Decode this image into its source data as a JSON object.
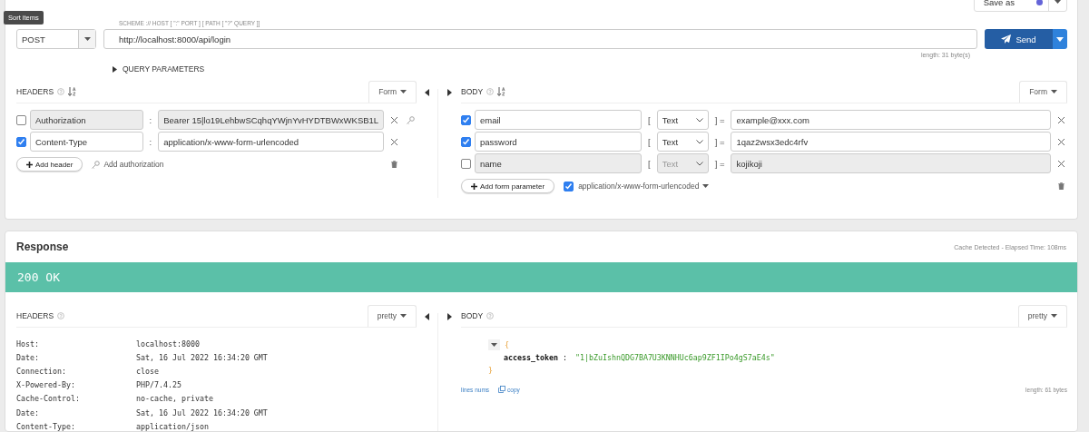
{
  "tooltip": {
    "text": "Sort items"
  },
  "request": {
    "save_button": "Save as",
    "method": "POST",
    "url_hint": "SCHEME :// HOST [ \":\" PORT ] [ PATH [ \"?\" QUERY ]]",
    "url": "http://localhost:8000/api/login",
    "url_length": "length: 31 byte(s)",
    "send_button": "Send",
    "query_parameters": {
      "label": "QUERY PARAMETERS",
      "expanded": false
    },
    "headers": {
      "title": "HEADERS",
      "mode": "Form",
      "add_button": "Add header",
      "add_auth": "Add authorization",
      "rows": [
        {
          "name": "Authorization",
          "separator": ":",
          "value": "Bearer 15|lo19LehbwSCqhqYWjnYvHYDTBWxWKSB1L",
          "checked": false
        },
        {
          "name": "Content-Type",
          "separator": ":",
          "value": "application/x-www-form-urlencoded",
          "checked": true
        }
      ]
    },
    "body": {
      "title": "BODY",
      "mode": "Form",
      "add_button": "Add form parameter",
      "content_type": {
        "label": "application/x-www-form-urlencoded",
        "checked": true
      },
      "rows": [
        {
          "name": "email",
          "open": "[",
          "type": "Text",
          "close": "] =",
          "value": "example@xxx.com",
          "checked": true
        },
        {
          "name": "password",
          "open": "[",
          "type": "Text",
          "close": "] =",
          "value": "1qaz2wsx3edc4rfv",
          "checked": true
        },
        {
          "name": "name",
          "open": "[",
          "type": "Text",
          "close": "] =",
          "value": "kojikoji",
          "checked": false
        }
      ]
    }
  },
  "response": {
    "title": "Response",
    "cache_info": "Cache Detected - Elapsed Time: 108ms",
    "status": "200 OK",
    "headers": {
      "title": "HEADERS",
      "mode": "pretty",
      "rows": [
        {
          "name": "Host:",
          "value": "localhost:8000"
        },
        {
          "name": "Date:",
          "value": "Sat, 16 Jul 2022 16:34:20 GMT"
        },
        {
          "name": "Connection:",
          "value": "close"
        },
        {
          "name": "X-Powered-By:",
          "value": "PHP/7.4.25"
        },
        {
          "name": "Cache-Control:",
          "value": "no-cache, private"
        },
        {
          "name": "Date:",
          "value": "Sat, 16 Jul 2022 16:34:20 GMT"
        },
        {
          "name": "Content-Type:",
          "value": "application/json"
        }
      ]
    },
    "body": {
      "title": "BODY",
      "mode": "pretty",
      "open_brace": "{",
      "close_brace": "}",
      "entries": [
        {
          "key": "access_token",
          "separator": ":",
          "value": "\"1|bZuIshnQDG7BA7U3KNNHUc6ap9ZF1IPo4gS7aE4s\""
        }
      ],
      "lines_nums": "lines nums",
      "copy": "copy",
      "length": "length: 61 bytes"
    }
  }
}
